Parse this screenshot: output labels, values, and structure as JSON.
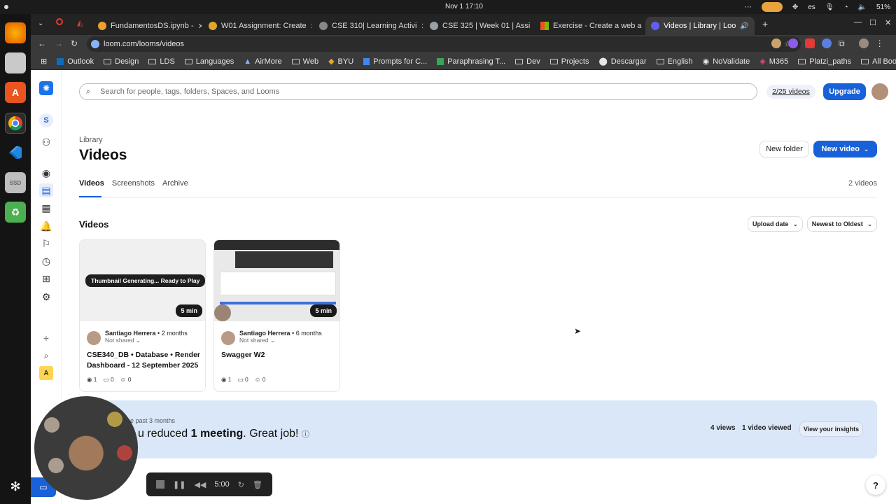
{
  "os": {
    "clock": "Nov 1  17:10",
    "keyboard": "es",
    "battery": "51%"
  },
  "browser": {
    "tabs": [
      {
        "title": "FundamentosDS.ipynb -",
        "color": "#f1a12b"
      },
      {
        "title": "W01 Assignment: Create",
        "color": "#e1a72c"
      },
      {
        "title": "CSE 310| Learning Activi",
        "color": "#888888"
      },
      {
        "title": "CSE 325 | Week 01 | Assi",
        "color": "#9aa0a6"
      },
      {
        "title": "Exercise - Create a web a",
        "color": "#f25022"
      },
      {
        "title": "Videos | Library | Loo",
        "color": "#625df5"
      }
    ],
    "url": "loom.com/looms/videos",
    "bookmarks": [
      "Outlook",
      "Design",
      "LDS",
      "Languages",
      "AirMore",
      "Web",
      "BYU",
      "Prompts for C...",
      "Paraphrasing T...",
      "Dev",
      "Projects",
      "Descargar",
      "English",
      "NoValidate",
      "M365",
      "Platzi_paths"
    ],
    "all_bookmarks": "All Bookmarks"
  },
  "app": {
    "workspace_initial": "S",
    "bottom_initial": "A",
    "search_placeholder": "Search for people, tags, folders, Spaces, and Looms",
    "quota": "2/25 videos",
    "upgrade": "Upgrade",
    "breadcrumb": "Library",
    "title": "Videos",
    "new_folder": "New folder",
    "new_video": "New video",
    "tabs": [
      "Videos",
      "Screenshots",
      "Archive"
    ],
    "count": "2 videos",
    "section": "Videos",
    "sort_by": "Upload date",
    "order": "Newest to Oldest",
    "videos": [
      {
        "author": "Santiago Herrera",
        "age": "2 months",
        "sharing": "Not shared",
        "title": "CSE340_DB  •  Database  •  Render Dashboard - 12 September 2025",
        "duration": "5 min",
        "badge": "Thumbnail Generating... Ready to Play",
        "views": "1",
        "comments": "0",
        "reactions": "0"
      },
      {
        "author": "Santiago Herrera",
        "age": "6 months",
        "sharing": "Not shared",
        "title": "Swagger W2",
        "duration": "5 min",
        "badge": "",
        "views": "1",
        "comments": "0",
        "reactions": "0"
      }
    ],
    "insight": {
      "period": "he past 3 months",
      "prefix": "u reduced ",
      "strong": "1 meeting",
      "suffix": ". Great job!",
      "views": "4 views",
      "viewed": "1 video viewed",
      "cta": "View your insights"
    },
    "recorder_time": "5:00",
    "help": "?"
  }
}
